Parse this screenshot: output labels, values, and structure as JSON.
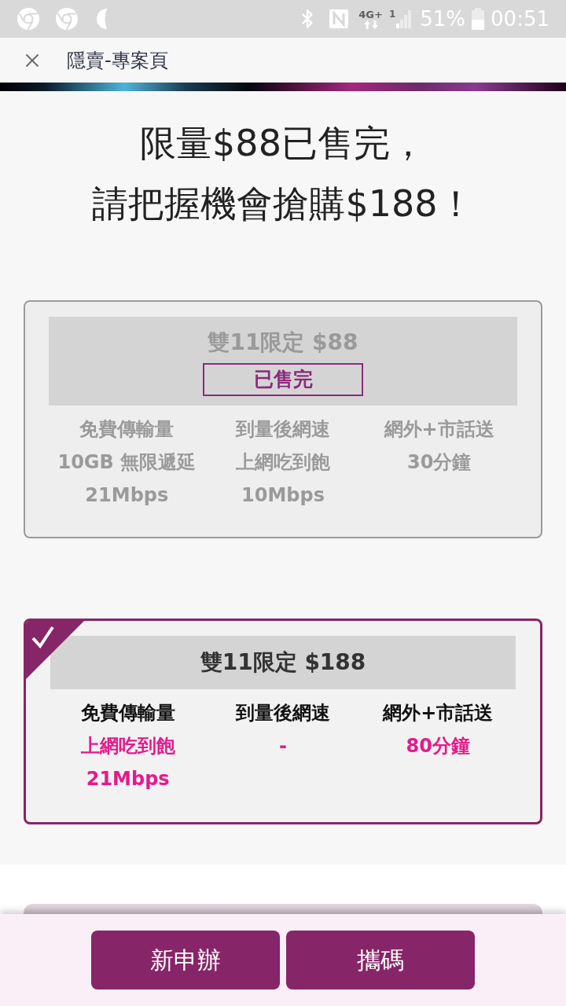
{
  "status_bar": {
    "network": "4G+",
    "sim": "1",
    "battery_percent": "51%",
    "time": "00:51"
  },
  "toolbar": {
    "title": "隱賣-專案頁"
  },
  "headline": [
    "限量$88已售完，",
    "請把握機會搶購$188！"
  ],
  "plans": [
    {
      "title": "雙11限定 $88",
      "badge": "已售完",
      "selected": false,
      "disabled": true,
      "features": [
        {
          "label": "免費傳輸量",
          "values": [
            "10GB 無限遞延",
            "21Mbps"
          ]
        },
        {
          "label": "到量後網速",
          "values": [
            "上網吃到飽",
            "10Mbps"
          ]
        },
        {
          "label": "網外+市話送",
          "values": [
            "30分鐘"
          ]
        }
      ]
    },
    {
      "title": "雙11限定 $188",
      "selected": true,
      "disabled": false,
      "features": [
        {
          "label": "免費傳輸量",
          "values": [
            "上網吃到飽",
            "21Mbps"
          ]
        },
        {
          "label": "到量後網速",
          "values": [
            "-"
          ]
        },
        {
          "label": "網外+市話送",
          "values": [
            "80分鐘"
          ]
        }
      ]
    }
  ],
  "actions": [
    "新申辦",
    "攜碼"
  ]
}
